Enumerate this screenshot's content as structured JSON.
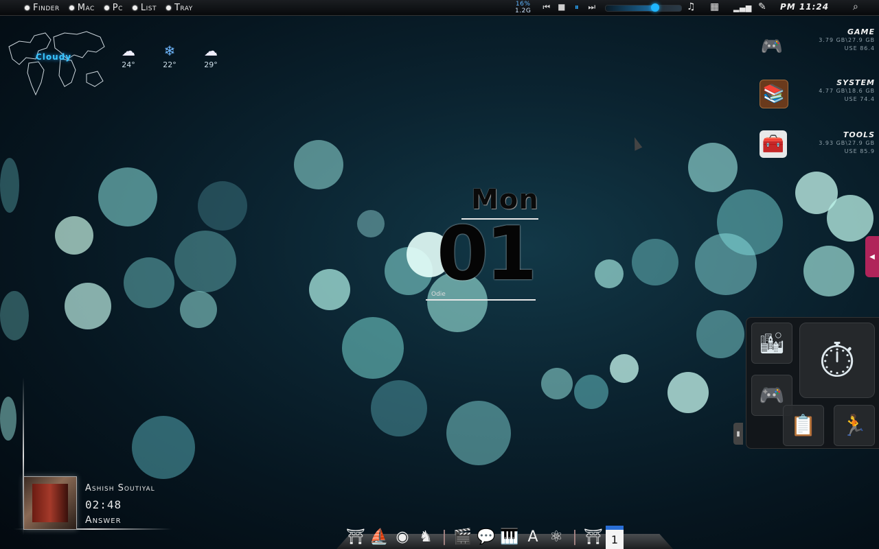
{
  "menubar": {
    "apple_icon": "apple-icon",
    "items": [
      "Finder",
      "Mac",
      "Pc",
      "List",
      "Tray"
    ]
  },
  "network": {
    "percent": "16%",
    "amount": "1.2G"
  },
  "media": {
    "prev": "⏮",
    "stop": "■",
    "pause": "⏸",
    "next": "⏭",
    "volume_level": 0.65
  },
  "clock": {
    "time": "PM 11:24"
  },
  "weather": {
    "condition": "Cloudy",
    "forecast": [
      {
        "icon": "cloud-icon",
        "glyph": "☁",
        "temp": "24°"
      },
      {
        "icon": "snow-icon",
        "glyph": "❄",
        "temp": "22°"
      },
      {
        "icon": "cloud-icon",
        "glyph": "☁",
        "temp": "29°"
      }
    ]
  },
  "drives": [
    {
      "name": "Game",
      "size": "3.79 GB\\27.9 GB",
      "use": "USE 86.4",
      "icon": "gamepad-icon",
      "glyph": "🎮"
    },
    {
      "name": "System",
      "size": "4.77 GB\\18.6 GB",
      "use": "USE 74.4",
      "icon": "bookshelf-icon",
      "glyph": "📚"
    },
    {
      "name": "Tools",
      "size": "3.93 GB\\27.9 GB",
      "use": "USE 85.9",
      "icon": "toolbox-icon",
      "glyph": "🧰"
    }
  ],
  "date_widget": {
    "day": "Mon",
    "date": "01",
    "sub": "Odie"
  },
  "panel_tiles": [
    {
      "icon": "simcity-icon",
      "glyph": "🏙"
    },
    {
      "icon": "speedometer-icon",
      "glyph": "⏱"
    },
    {
      "icon": "xbox-controller-icon",
      "glyph": "🎮"
    },
    {
      "icon": "task-list-icon",
      "glyph": "📋"
    },
    {
      "icon": "portal-icon",
      "glyph": "🏃"
    }
  ],
  "music": {
    "artist": "Ashish Soutiyal",
    "time": "02:48",
    "track": "Answer"
  },
  "dock": [
    {
      "icon": "gate-icon",
      "glyph": "⛩"
    },
    {
      "icon": "ship-icon",
      "glyph": "⛵"
    },
    {
      "icon": "orb-icon",
      "glyph": "◉"
    },
    {
      "icon": "chess-icon",
      "glyph": "♞"
    },
    {
      "icon": "divider-icon",
      "glyph": "|"
    },
    {
      "icon": "clapper-icon",
      "glyph": "🎬"
    },
    {
      "icon": "chat-icon",
      "glyph": "💬"
    },
    {
      "icon": "piano-icon",
      "glyph": "🎹"
    },
    {
      "icon": "app-store-icon",
      "glyph": "A"
    },
    {
      "icon": "atom-icon",
      "glyph": "⚛"
    },
    {
      "icon": "divider-icon",
      "glyph": "|"
    },
    {
      "icon": "torii-icon",
      "glyph": "⛩"
    },
    {
      "icon": "calendar-icon",
      "glyph": "1"
    }
  ],
  "colors": {
    "accent": "#1fb6ff",
    "side_tab": "#b0245a",
    "weather_text": "#39c6ff"
  }
}
